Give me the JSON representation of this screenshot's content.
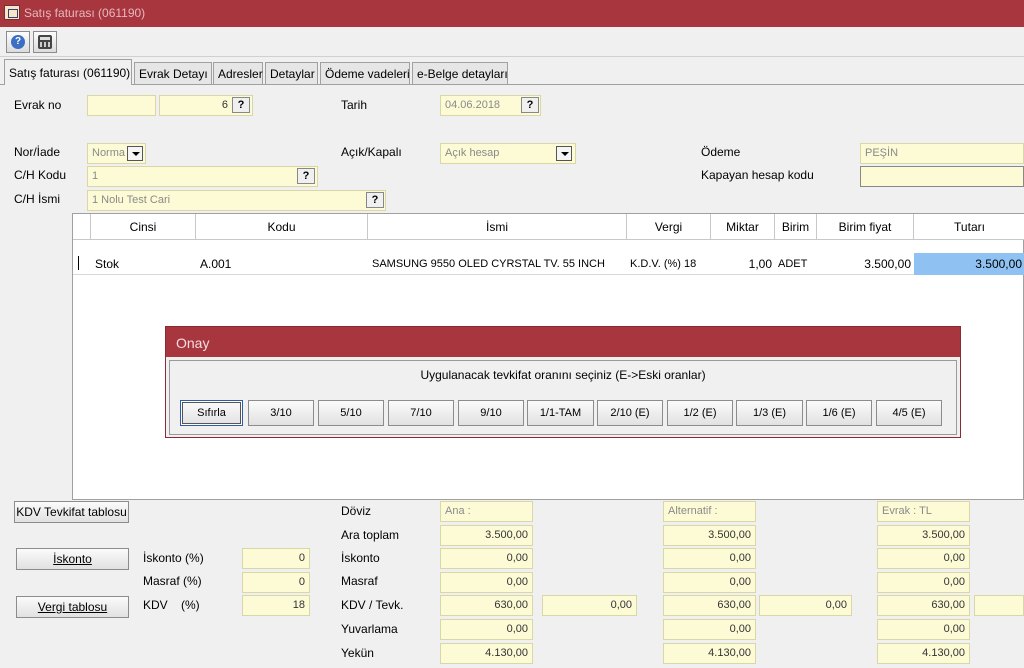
{
  "window": {
    "title": "Satış faturası (061190)"
  },
  "tabs": [
    "Satış faturası (061190)",
    "Evrak Detayı",
    "Adresler",
    "Detaylar",
    "Ödeme vadeleri",
    "e-Belge detayları"
  ],
  "header": {
    "evrak_no_label": "Evrak no",
    "evrak_no_series": "",
    "evrak_no_value": "6",
    "tarih_label": "Tarih",
    "tarih_value": "04.06.2018",
    "nor_iade_label": "Nor/İade",
    "nor_iade_value": "Norma",
    "acik_kapali_label": "Açık/Kapalı",
    "acik_kapali_value": "Açık hesap",
    "odeme_label": "Ödeme",
    "odeme_value": "PEŞİN",
    "kapayan_label": "Kapayan hesap kodu",
    "kapayan_value": "",
    "ch_kodu_label": "C/H Kodu",
    "ch_kodu_value": "1",
    "ch_ismi_label": "C/H İsmi",
    "ch_ismi_value": "1 Nolu Test Cari",
    "lookup_glyph": "?"
  },
  "grid": {
    "columns": [
      "Cinsi",
      "Kodu",
      "İsmi",
      "Vergi",
      "Miktar",
      "Birim",
      "Birim fiyat",
      "Tutarı"
    ],
    "rows": [
      {
        "cinsi": "Stok",
        "kodu": "A.001",
        "ismi": "SAMSUNG 9550 OLED CYRSTAL TV. 55 INCH",
        "vergi": "K.D.V. (%) 18",
        "miktar": "1,00",
        "birim": "ADET",
        "birim_fiyat": "3.500,00",
        "tutar": "3.500,00"
      }
    ]
  },
  "dialog": {
    "title": "Onay",
    "message": "Uygulanacak tevkifat oranını seçiniz (E->Eski oranlar)",
    "buttons": [
      "Sıfırla",
      "3/10",
      "5/10",
      "7/10",
      "9/10",
      "1/1-TAM",
      "2/10 (E)",
      "1/2 (E)",
      "1/3 (E)",
      "1/6 (E)",
      "4/5 (E)"
    ]
  },
  "bottom": {
    "kdv_tevkifat_button": "KDV Tevkifat tablosu",
    "iskonto_button": "İskonto",
    "vergi_button": "Vergi tablosu",
    "iskonto_pct_label": "İskonto (%)",
    "iskonto_pct_value": "0",
    "masraf_pct_label": "Masraf (%)",
    "masraf_pct_value": "0",
    "kdv_label": "KDV",
    "kdv_pct_suffix": "(%)",
    "kdv_pct_value": "18",
    "totals_labels": [
      "Döviz",
      "Ara toplam",
      "İskonto",
      "Masraf",
      "KDV / Tevk.",
      "Yuvarlama",
      "Yekün"
    ],
    "ana": {
      "header": "Ana :",
      "values": [
        "3.500,00",
        "0,00",
        "0,00",
        "630,00",
        "0,00",
        "4.130,00"
      ],
      "tevk": "0,00"
    },
    "alternatif": {
      "header": "Alternatif :",
      "values": [
        "3.500,00",
        "0,00",
        "0,00",
        "630,00",
        "0,00",
        "4.130,00"
      ],
      "tevk": "0,00"
    },
    "evrak": {
      "header": "Evrak : TL",
      "values": [
        "3.500,00",
        "0,00",
        "0,00",
        "630,00",
        "0,00",
        "4.130,00"
      ],
      "tevk": ""
    }
  }
}
